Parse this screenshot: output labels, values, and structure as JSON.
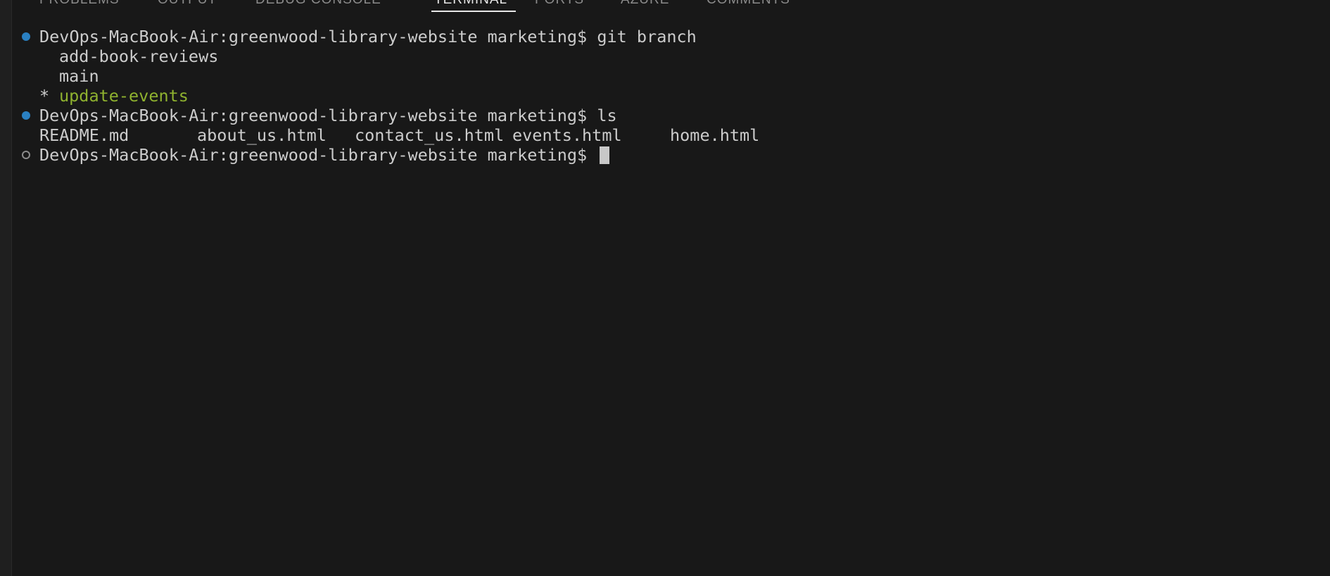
{
  "panel": {
    "tabs": [
      {
        "label": "PROBLEMS",
        "active": false
      },
      {
        "label": "OUTPUT",
        "active": false
      },
      {
        "label": "DEBUG CONSOLE",
        "active": false
      },
      {
        "label": "TERMINAL",
        "active": true
      },
      {
        "label": "PORTS",
        "active": false
      },
      {
        "label": "AZURE",
        "active": false
      },
      {
        "label": "COMMENTS",
        "active": false
      }
    ]
  },
  "terminal": {
    "prompt": "DevOps-MacBook-Air:greenwood-library-website marketing$",
    "commands": [
      {
        "text": "git branch",
        "status": "success"
      },
      {
        "text": "ls",
        "status": "success"
      }
    ],
    "branches": [
      {
        "name": "add-book-reviews",
        "current": false
      },
      {
        "name": "main",
        "current": false
      },
      {
        "name": "update-events",
        "current": true,
        "marker": "*"
      }
    ],
    "ls_output": [
      "README.md",
      "about_us.html",
      "contact_us.html",
      "events.html",
      "home.html"
    ],
    "current_input": "",
    "colors": {
      "background": "#181818",
      "text": "#cccccc",
      "current_branch": "#8fb22f",
      "decoration_success": "#2a80c1",
      "decoration_pending": "#8b8b8b",
      "cursor": "#c8c8c8"
    }
  }
}
